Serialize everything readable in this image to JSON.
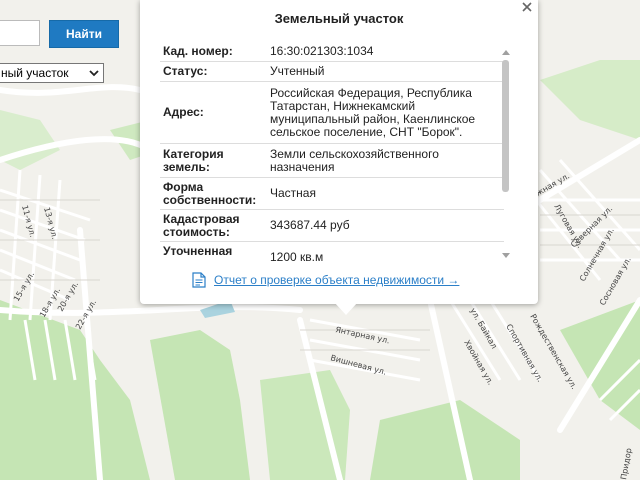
{
  "search": {
    "find_label": "Найти",
    "value": ""
  },
  "layer_select": {
    "selected": "ный участок"
  },
  "popup": {
    "title": "Земельный участок",
    "rows": [
      {
        "label": "Кад. номер:",
        "value": "16:30:021303:1034"
      },
      {
        "label": "Статус:",
        "value": "Учтенный"
      },
      {
        "label": "Адрес:",
        "value": "Российская Федерация, Республика Татарстан, Нижнекамский муниципальный район, Каенлинское сельское поселение, СНТ \"Борок\"."
      },
      {
        "label": "Категория земель:",
        "value": "Земли сельскохозяйственного назначения"
      },
      {
        "label": "Форма собственности:",
        "value": "Частная"
      },
      {
        "label": "Кадастровая стоимость:",
        "value": "343687.44 руб"
      },
      {
        "label": "Уточненная площадь:",
        "value": "1200 кв.м"
      }
    ],
    "report_link": "Отчет о проверке объекта недвижимости →"
  },
  "map": {
    "streets": {
      "yantarnaya": "Янтарная ул.",
      "vishnevaya": "Вишневая ул.",
      "baikal": "ул. Байкал",
      "hvoinaya": "Хвойная ул.",
      "sportivnaya": "Спортивная ул.",
      "rozhdestvenskaya": "Рождественская ул.",
      "zhnaya": "жная ул.",
      "lugovaya": "Луговая ул.",
      "severnaya": "Северная ул.",
      "solnechnaya": "Солнечная ул.",
      "sosnovaya": "Сосновая ул.",
      "u22a": "22-я ул.",
      "u20a": "20-я ул.",
      "u18a": "18-я ул.",
      "u15a": "15-я ул.",
      "u13a": "13-я ул.",
      "u11a": "11-я ул.",
      "pridor": "Придор"
    }
  },
  "colors": {
    "accent": "#1f7ac2",
    "link": "#2b7fc8",
    "park": "#c5e5b4",
    "road": "#ffffff"
  }
}
